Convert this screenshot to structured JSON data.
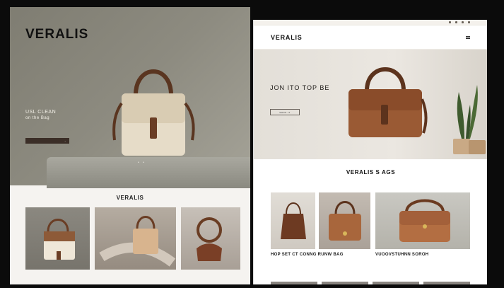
{
  "left_page": {
    "brand": "VERALIS",
    "hero_title_line1": "USL CLEAN",
    "hero_title_line2": "on the Bag",
    "hero_cta_arrow": "→",
    "slider_dots": "• •",
    "section_title": "VERALIS"
  },
  "right_page": {
    "brand": "VERALIS",
    "hero_title": "JON ITO TOP BE",
    "hero_cta": "SHOP IT",
    "section_title": "VERALIS S AGS",
    "products": [
      {
        "name": "HOP SET CT CONNG RUNW BAG"
      },
      {
        "name": "VUOOVSTUHNN SOROH"
      }
    ]
  },
  "colors": {
    "dark_bg": "#0b0b0b",
    "hero_grey": "#8d8b80",
    "cream_bag": "#e6dcc8",
    "brown_leather": "#9a5a34",
    "dark_cta": "#3b2e27"
  }
}
